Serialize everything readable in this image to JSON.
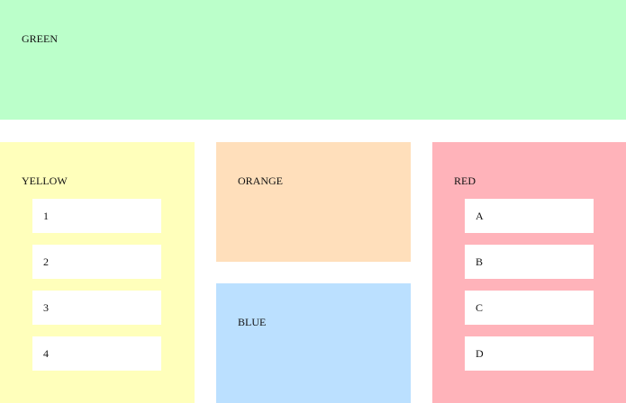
{
  "panels": {
    "green": {
      "label": "GREEN",
      "color": "#bbffca"
    },
    "yellow": {
      "label": "YELLOW",
      "color": "#ffffbb",
      "items": [
        "1",
        "2",
        "3",
        "4"
      ]
    },
    "orange": {
      "label": "ORANGE",
      "color": "#ffdfbb"
    },
    "blue": {
      "label": "BLUE",
      "color": "#bbe0ff"
    },
    "red": {
      "label": "RED",
      "color": "#ffb3ba",
      "items": [
        "A",
        "B",
        "C",
        "D"
      ]
    }
  }
}
